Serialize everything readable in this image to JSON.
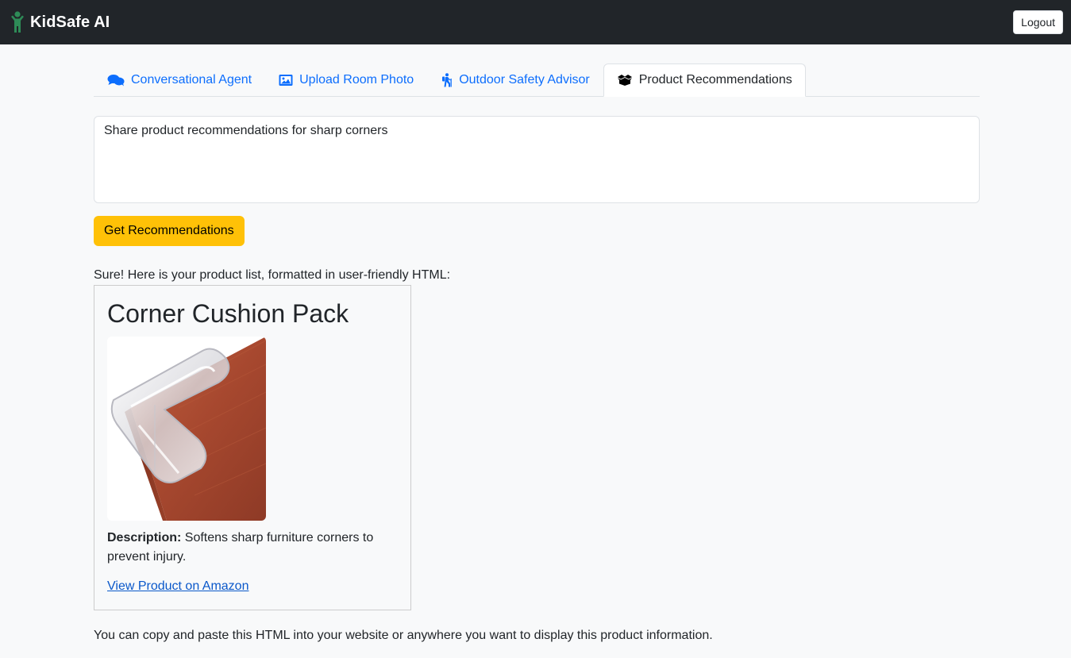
{
  "app": {
    "brand": "KidSafe AI",
    "logout_label": "Logout"
  },
  "tabs": [
    {
      "label": "Conversational Agent",
      "icon": "comments-icon",
      "active": false
    },
    {
      "label": "Upload Room Photo",
      "icon": "image-icon",
      "active": false
    },
    {
      "label": "Outdoor Safety Advisor",
      "icon": "hiking-icon",
      "active": false
    },
    {
      "label": "Product Recommendations",
      "icon": "box-open-icon",
      "active": true
    }
  ],
  "form": {
    "prompt_value": "Share product recommendations for sharp corners",
    "submit_label": "Get Recommendations"
  },
  "result": {
    "intro": "Sure! Here is your product list, formatted in user-friendly HTML:",
    "product": {
      "title": "Corner Cushion Pack",
      "description_label": "Description:",
      "description": " Softens sharp furniture corners to prevent injury.",
      "link_label": "View Product on Amazon"
    },
    "outro": "You can copy and paste this HTML into your website or anywhere you want to display this product information."
  },
  "colors": {
    "navbar": "#212529",
    "brand_icon": "#2e8b57",
    "link": "#0d6efd",
    "primary_button": "#ffc107"
  }
}
